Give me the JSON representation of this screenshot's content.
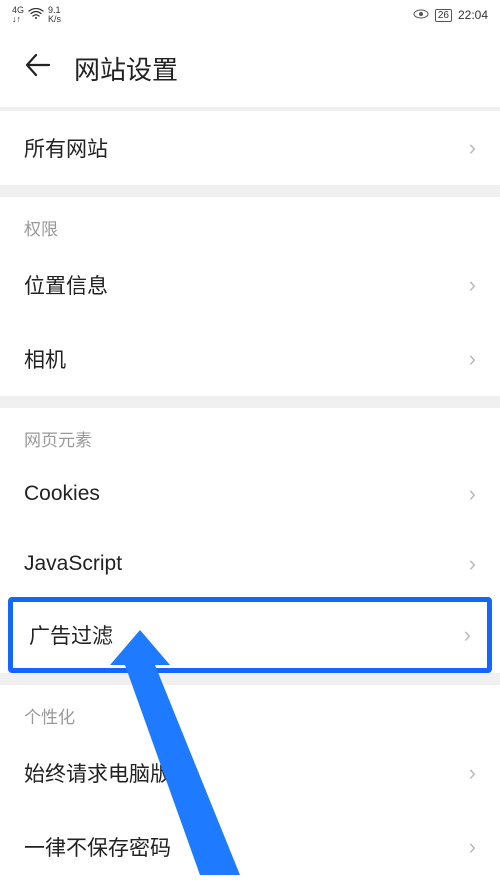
{
  "status_bar": {
    "network": "4G",
    "signal_down": "↓↑",
    "speed": "9.1",
    "speed_unit": "K/s",
    "battery": "26",
    "time": "22:04"
  },
  "header": {
    "title": "网站设置"
  },
  "sections": {
    "all_sites": "所有网站",
    "perms_header": "权限",
    "location": "位置信息",
    "camera": "相机",
    "elements_header": "网页元素",
    "cookies": "Cookies",
    "javascript": "JavaScript",
    "ad_filter": "广告过滤",
    "personalization_header": "个性化",
    "desktop": "始终请求电脑版",
    "no_password": "一律不保存密码"
  }
}
